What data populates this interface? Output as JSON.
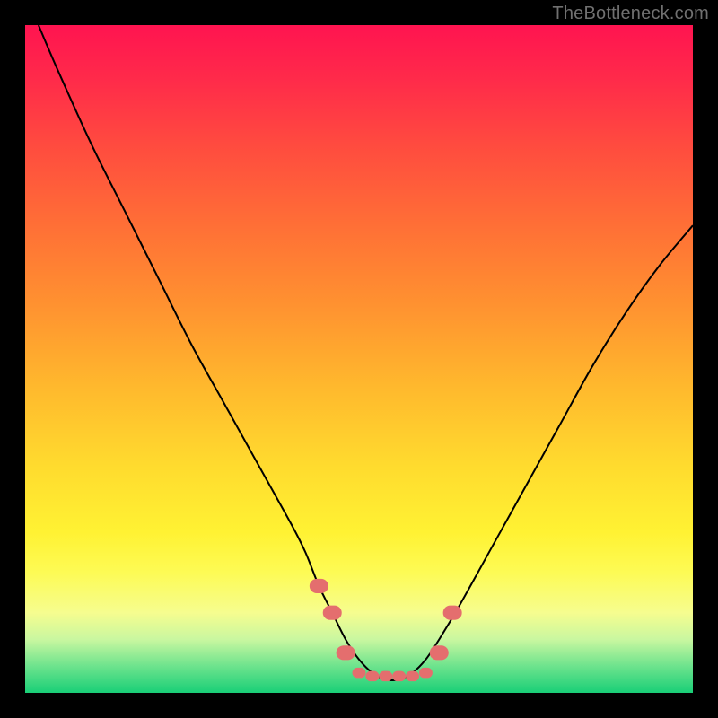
{
  "watermark": "TheBottleneck.com",
  "chart_data": {
    "type": "line",
    "title": "",
    "xlabel": "",
    "ylabel": "",
    "xlim": [
      0,
      100
    ],
    "ylim": [
      0,
      100
    ],
    "series": [
      {
        "name": "bottleneck-curve",
        "x": [
          2,
          5,
          10,
          15,
          20,
          25,
          30,
          35,
          40,
          42,
          44,
          46,
          48,
          50,
          52,
          54,
          56,
          58,
          60,
          62,
          65,
          70,
          75,
          80,
          85,
          90,
          95,
          100
        ],
        "values": [
          100,
          93,
          82,
          72,
          62,
          52,
          43,
          34,
          25,
          21,
          16,
          12,
          8,
          5,
          3,
          2,
          2,
          3,
          5,
          8,
          13,
          22,
          31,
          40,
          49,
          57,
          64,
          70
        ]
      }
    ],
    "markers": {
      "name": "highlight-points",
      "x": [
        44,
        46,
        48,
        50,
        52,
        54,
        56,
        58,
        60,
        62,
        64
      ],
      "values": [
        16,
        12,
        6,
        3,
        2.5,
        2.5,
        2.5,
        2.5,
        3,
        6,
        12
      ],
      "color": "#e46e6e",
      "size_large": 14,
      "size_small": 10
    },
    "curve_color": "#000000",
    "curve_width": 2
  }
}
